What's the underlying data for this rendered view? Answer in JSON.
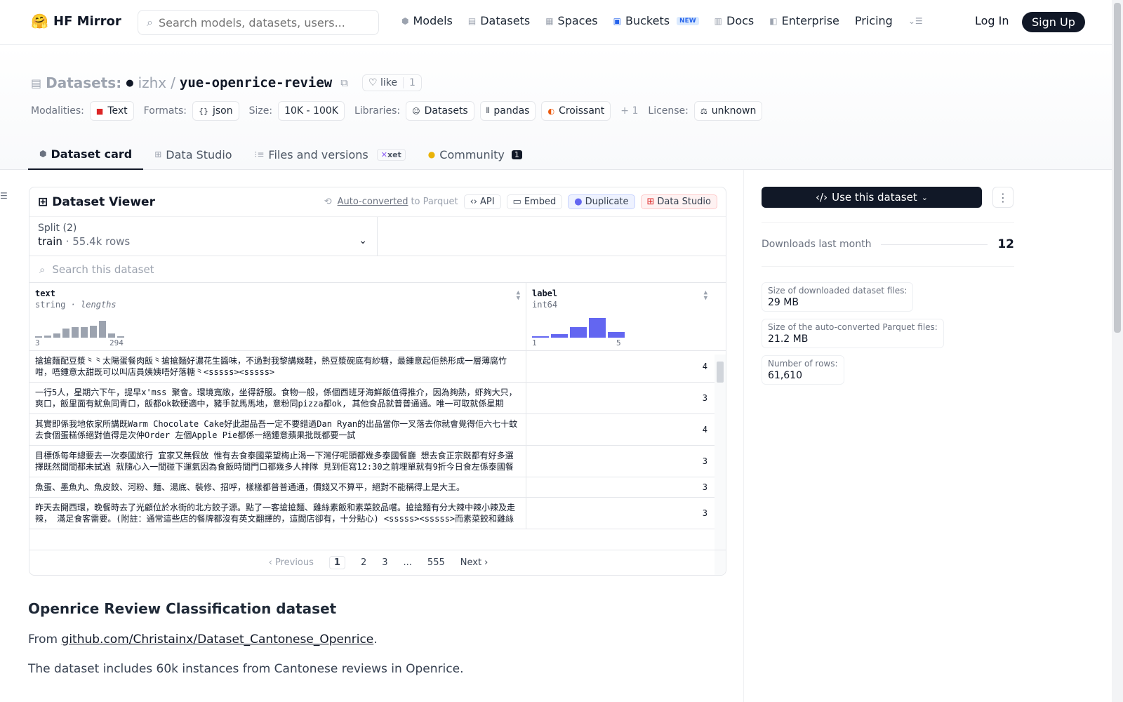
{
  "nav": {
    "brand": "HF Mirror",
    "search_placeholder": "Search models, datasets, users...",
    "items": [
      {
        "label": "Models",
        "icon": "cube-icon"
      },
      {
        "label": "Datasets",
        "icon": "database-icon"
      },
      {
        "label": "Spaces",
        "icon": "grid-icon"
      },
      {
        "label": "Buckets",
        "icon": "bucket-icon",
        "badge": "NEW"
      },
      {
        "label": "Docs",
        "icon": "book-icon"
      },
      {
        "label": "Enterprise",
        "icon": "enterprise-icon"
      },
      {
        "label": "Pricing"
      }
    ],
    "login": "Log In",
    "signup": "Sign Up"
  },
  "header": {
    "prefix": "Datasets:",
    "owner": "izhx",
    "sep": "/",
    "name": "yue-openrice-review",
    "like_label": "like",
    "like_count": "1",
    "tags": {
      "modalities_label": "Modalities:",
      "modality": "Text",
      "formats_label": "Formats:",
      "format": "json",
      "size_label": "Size:",
      "size": "10K - 100K",
      "libraries_label": "Libraries:",
      "lib1": "Datasets",
      "lib2": "pandas",
      "lib3": "Croissant",
      "more": "+ 1",
      "license_label": "License:",
      "license": "unknown"
    }
  },
  "tabs": [
    {
      "label": "Dataset card",
      "active": true
    },
    {
      "label": "Data Studio"
    },
    {
      "label": "Files and versions",
      "badge": "xet"
    },
    {
      "label": "Community",
      "count": "1"
    }
  ],
  "viewer": {
    "title": "Dataset Viewer",
    "auto_converted": "Auto-converted",
    "to_parquet": "to Parquet",
    "api": "API",
    "embed": "Embed",
    "duplicate": "Duplicate",
    "data_studio": "Data Studio",
    "split_label": "Split (2)",
    "split_name": "train",
    "split_dot": "·",
    "split_rows": "55.4k rows",
    "search_placeholder": "Search this dataset",
    "columns": [
      {
        "name": "text",
        "type": "string",
        "type_extra": "· lengths",
        "min": "3",
        "max": "294"
      },
      {
        "name": "label",
        "type": "int64",
        "min": "1",
        "max": "5"
      }
    ],
    "rows": [
      {
        "text": "搶搶麵配豆漿⺀⺀太陽蛋餐肉飯⺀搶搶麵好濃花生醬味，不過對我黎講幾鞋，熱豆漿碗底有紗糖，最鍾意起佢熱形成一層薄腐竹咁，唔鍾意太甜既可以叫店員姨姨唔好落糖⺀<sssss><sssss>",
        "label": "4"
      },
      {
        "text": "一行5人，星期六下午，提早x'mss 聚會。環境寬敞，坐得舒服。食物一般，係個西班牙海鮮飯值得推介，因為夠熱，虾夠大只，爽口，飯里面有魷魚同青口，飯都ok軟硬適中，豬手就馬馬地，意粉同pizza都ok, 其他食品就普普通通。唯一可取就係星期",
        "label": "3"
      },
      {
        "text": "其實即係我地依家所講既Warm Chocolate Cake好此甜品吾一定不要錯過Dan Ryan的出品當你一叉落去你就會覺得佢六七十蚊去食個蛋糕係絕對值得是次仲Order 左個Apple Pie都係一絕鍾意蘋果批既都要一試",
        "label": "4"
      },
      {
        "text": "目標係每年總要去一次泰國旅行 宜家又無假放 惟有去食泰國菜望梅止渴一下灣仔呢頭都幾多泰國餐廳 想去食正宗既都有好多選擇既然間間都未試過 就隨心入一間碰下運氣因為食飯時間門口都幾多人排隊 見到佢寫12:30之前埋單就有9折今日食左係泰國餐",
        "label": "3"
      },
      {
        "text": "魚蛋、墨魚丸、魚皮餃、河粉、麵、湯底、裝修、招呼，樣樣都普普通通，價錢又不算平，絕對不能稱得上是大王。",
        "label": "3"
      },
      {
        "text": "昨天去開西環，晚餐時去了光顧位於水街的北方餃子源。點了一客搶搶麵、雞絲素飯和素菜餃品嚐。搶搶麵有分大辣中辣小辣及走辣， 滿足食客需要。(附註：通常這些店的餐牌都沒有英文翻譯的，這間店卻有，十分貼心) <sssss><sssss>而素菜餃和雞絲",
        "label": "3"
      }
    ],
    "pager": {
      "prev": "Previous",
      "pages": [
        "1",
        "2",
        "3",
        "...",
        "555"
      ],
      "next": "Next"
    }
  },
  "content": {
    "heading": "Openrice Review Classification dataset",
    "from_label": "From ",
    "link": "github.com/Christainx/Dataset_Cantonese_Openrice",
    "from_end": ".",
    "desc": "The dataset includes 60k instances from Cantonese reviews in Openrice."
  },
  "sidebar": {
    "use_button": "Use this dataset",
    "downloads_label": "Downloads last month",
    "downloads_value": "12",
    "stats": [
      {
        "label": "Size of downloaded dataset files:",
        "value": "29 MB"
      },
      {
        "label": "Size of the auto-converted Parquet files:",
        "value": "21.2 MB"
      },
      {
        "label": "Number of rows:",
        "value": "61,610"
      }
    ]
  },
  "histograms": {
    "text_lengths": [
      0.03,
      0.1,
      0.2,
      0.45,
      0.55,
      0.55,
      0.6,
      0.85,
      0.2,
      0.05
    ],
    "label": [
      0.08,
      0.18,
      0.55,
      1.0,
      0.3
    ]
  },
  "colors": {
    "accent": "#6366f1",
    "dark": "#111827"
  }
}
